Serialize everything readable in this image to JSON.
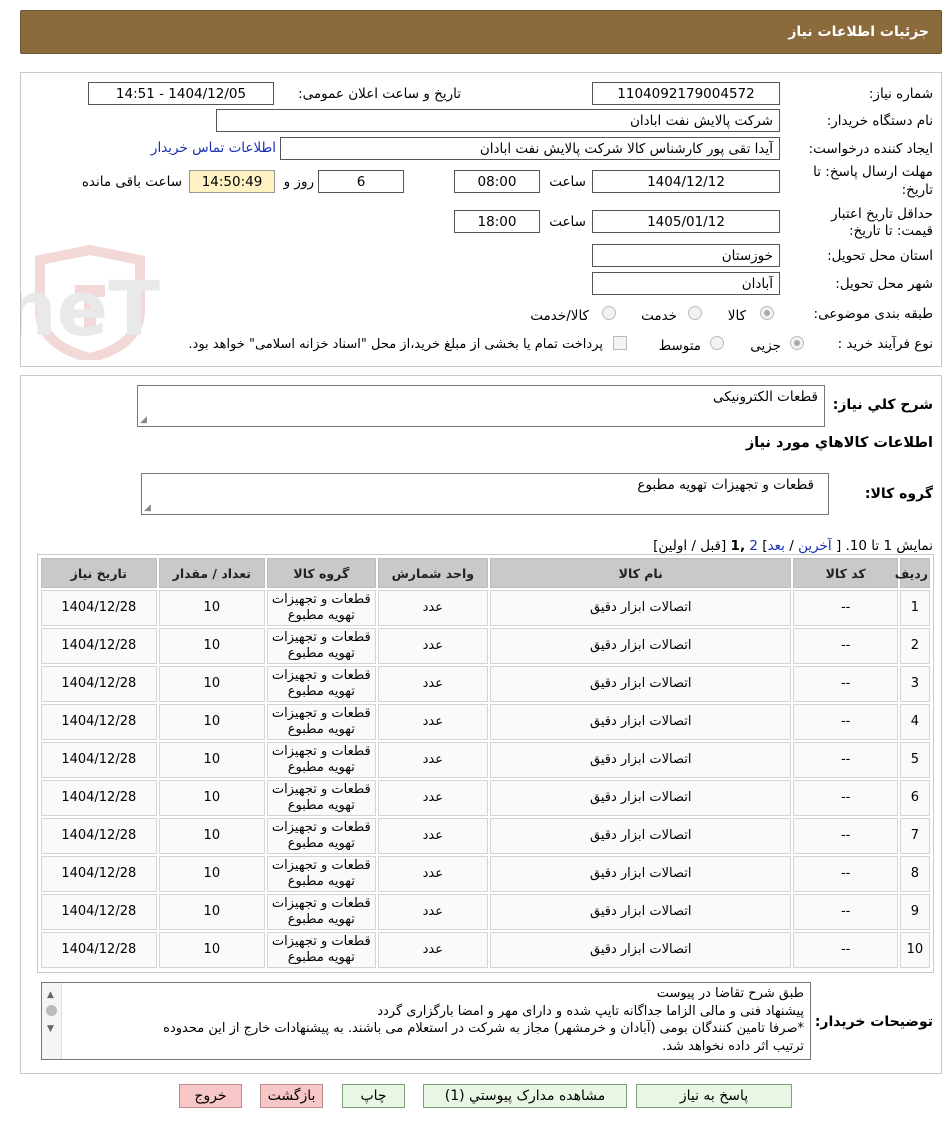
{
  "header": {
    "title": "جزئیات اطلاعات نیاز"
  },
  "form": {
    "need_number_label": "شماره نیاز:",
    "need_number": "1104092179004572",
    "announce_label": "تاریخ و ساعت اعلان عمومی:",
    "announce_value": "1404/12/05 - 14:51",
    "buyer_org_label": "نام دستگاه خریدار:",
    "buyer_org": "شرکت پالایش نفت ابادان",
    "creator_label": "ایجاد کننده درخواست:",
    "creator": "آیدا تقی پور کارشناس کالا شرکت پالایش نفت ابادان",
    "contact_link": "اطلاعات تماس خریدار",
    "reply_deadline_label_1": "مهلت ارسال پاسخ: تا",
    "reply_deadline_label_2": "تاریخ:",
    "reply_date": "1404/12/12",
    "time_label": "ساعت",
    "reply_time": "08:00",
    "days_value": "6",
    "days_label": "روز و",
    "remaining_time": "14:50:49",
    "remaining_label": "ساعت باقی مانده",
    "validity_label_1": "حداقل تاریخ اعتبار",
    "validity_label_2": "قیمت: تا تاریخ:",
    "validity_date": "1405/01/12",
    "validity_time": "18:00",
    "province_label": "استان محل تحویل:",
    "province": "خوزستان",
    "city_label": "شهر محل تحویل:",
    "city": "آبادان",
    "category_label": "طبقه بندی موضوعی:",
    "category_options": [
      "کالا",
      "خدمت",
      "کالا/خدمت"
    ],
    "category_selected": "کالا",
    "process_label": "نوع فرآیند خرید :",
    "process_options": [
      "جزیی",
      "متوسط"
    ],
    "process_selected": "جزیی",
    "payment_note": "پرداخت تمام یا بخشی از مبلغ خرید،از محل \"اسناد خزانه اسلامی\" خواهد بود."
  },
  "details": {
    "summary_label": "شرح کلي نياز:",
    "summary": "قطعات الکترونیکی",
    "goods_info_title": "اطلاعات کالاهاي مورد نياز",
    "goods_group_label": "گروه کالا:",
    "goods_group": "قطعات و تجهیزات تهویه مطبوع",
    "pagination_prefix": "نمایش 1 تا 10. [",
    "pagination_last": "آخرین",
    "pagination_sep": "/",
    "pagination_next": "بعد",
    "pagination_page2": "2",
    "pagination_page1": "1",
    "pagination_suffix": "[قبل / اولین]"
  },
  "table": {
    "headers": [
      "ردیف",
      "کد کالا",
      "نام کالا",
      "واحد شمارش",
      "گروه کالا",
      "تعداد / مقدار",
      "تاریخ نیاز"
    ],
    "rows": [
      [
        "1",
        "--",
        "اتصالات ابزار دقیق",
        "عدد",
        "قطعات و تجهیزات تهویه مطبوع",
        "10",
        "1404/12/28"
      ],
      [
        "2",
        "--",
        "اتصالات ابزار دقیق",
        "عدد",
        "قطعات و تجهیزات تهویه مطبوع",
        "10",
        "1404/12/28"
      ],
      [
        "3",
        "--",
        "اتصالات ابزار دقیق",
        "عدد",
        "قطعات و تجهیزات تهویه مطبوع",
        "10",
        "1404/12/28"
      ],
      [
        "4",
        "--",
        "اتصالات ابزار دقیق",
        "عدد",
        "قطعات و تجهیزات تهویه مطبوع",
        "10",
        "1404/12/28"
      ],
      [
        "5",
        "--",
        "اتصالات ابزار دقیق",
        "عدد",
        "قطعات و تجهیزات تهویه مطبوع",
        "10",
        "1404/12/28"
      ],
      [
        "6",
        "--",
        "اتصالات ابزار دقیق",
        "عدد",
        "قطعات و تجهیزات تهویه مطبوع",
        "10",
        "1404/12/28"
      ],
      [
        "7",
        "--",
        "اتصالات ابزار دقیق",
        "عدد",
        "قطعات و تجهیزات تهویه مطبوع",
        "10",
        "1404/12/28"
      ],
      [
        "8",
        "--",
        "اتصالات ابزار دقیق",
        "عدد",
        "قطعات و تجهیزات تهویه مطبوع",
        "10",
        "1404/12/28"
      ],
      [
        "9",
        "--",
        "اتصالات ابزار دقیق",
        "عدد",
        "قطعات و تجهیزات تهویه مطبوع",
        "10",
        "1404/12/28"
      ],
      [
        "10",
        "--",
        "اتصالات ابزار دقیق",
        "عدد",
        "قطعات و تجهیزات تهویه مطبوع",
        "10",
        "1404/12/28"
      ]
    ]
  },
  "notes": {
    "label": "توضیحات خریدار:",
    "lines": [
      "طبق شرح تقاضا در پیوست",
      "پیشنهاد فنی و مالی الزاما جداگانه تایپ شده و دارای مهر و امضا بارگزاری گردد",
      "*صرفا تامین کنندگان بومی (آبادان و خرمشهر) مجاز به شرکت در استعلام می باشند. به پیشنهادات خارج از این محدوده",
      "ترتیب اثر داده نخواهد شد."
    ]
  },
  "buttons": {
    "reply": "پاسخ به نیاز",
    "attachments": "مشاهده مدارک پیوستي (1)",
    "print": "چاپ",
    "back": "بازگشت",
    "exit": "خروج"
  },
  "watermark": {
    "text": "AriaTender.neT"
  }
}
